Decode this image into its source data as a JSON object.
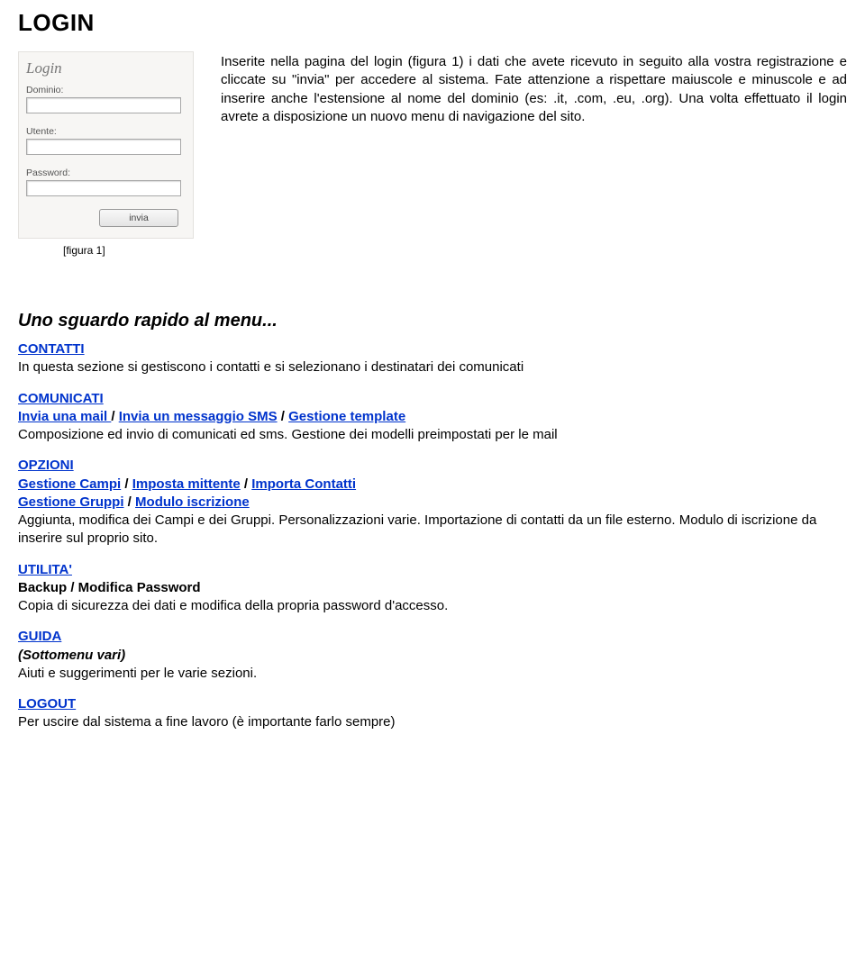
{
  "title": "LOGIN",
  "login_form": {
    "panel_label": "Login",
    "domain_label": "Dominio:",
    "user_label": "Utente:",
    "password_label": "Password:",
    "submit_label": "invia"
  },
  "intro_text": "Inserite nella pagina del login (figura 1) i dati che avete ricevuto in seguito alla vostra registrazione e cliccate su \"invia\" per accedere al sistema. Fate attenzione a rispettare maiuscole e minuscole e ad inserire anche l'estensione al nome del dominio (es: .it, .com, .eu, .org). Una volta effettuato il login avrete a disposizione un nuovo menu di navigazione del sito.",
  "figure_caption": "[figura 1]",
  "menu_heading": "Uno sguardo rapido al menu...",
  "contatti": {
    "title": "CONTATTI",
    "desc": "In questa sezione si gestiscono i contatti e si selezionano i destinatari dei comunicati"
  },
  "comunicati": {
    "title": "COMUNICATI",
    "link1": "Invia una mail ",
    "link2": "Invia un messaggio SMS",
    "link3": "Gestione template",
    "desc": "Composizione ed invio di comunicati ed sms. Gestione dei modelli preimpostati per le mail"
  },
  "opzioni": {
    "title": "OPZIONI",
    "row1_link1": "Gestione Campi",
    "row1_link2": "Imposta mittente",
    "row1_link3": "Importa Contatti",
    "row2_link1": "Gestione Gruppi",
    "row2_link2": "Modulo iscrizione",
    "desc": "Aggiunta, modifica dei Campi e dei Gruppi. Personalizzazioni varie. Importazione di contatti da un file esterno. Modulo di iscrizione da inserire sul proprio sito."
  },
  "utilita": {
    "title": "UTILITA'",
    "sub": "Backup / Modifica Password",
    "desc": "Copia di sicurezza dei dati e modifica della propria password d'accesso."
  },
  "guida": {
    "title": "GUIDA",
    "sub": "(Sottomenu vari)",
    "desc": "Aiuti  e suggerimenti per le varie sezioni."
  },
  "logout": {
    "title": "LOGOUT",
    "desc": "Per uscire dal sistema a fine lavoro (è importante farlo sempre)"
  }
}
